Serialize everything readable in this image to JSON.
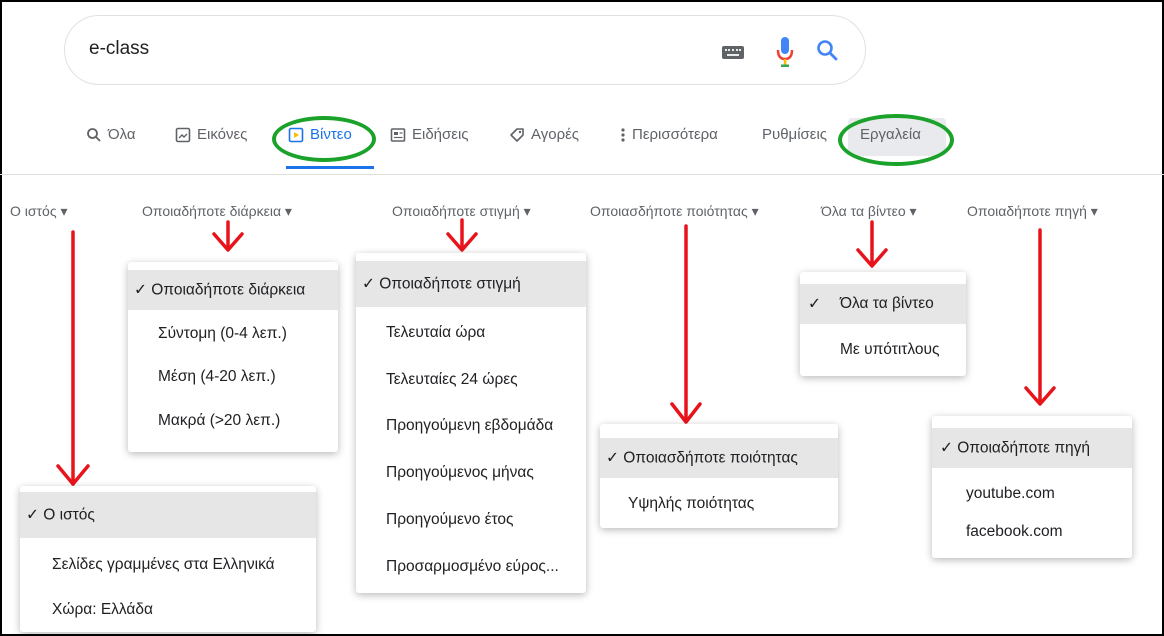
{
  "search": {
    "query": "e-class",
    "keyboard_icon": "keyboard-icon",
    "mic_icon": "mic-icon",
    "search_icon": "search-icon"
  },
  "tabs": [
    {
      "label": "Όλα",
      "icon": "search-icon",
      "active": false
    },
    {
      "label": "Εικόνες",
      "icon": "image-icon",
      "active": false
    },
    {
      "label": "Βίντεο",
      "icon": "video-icon",
      "active": true
    },
    {
      "label": "Ειδήσεις",
      "icon": "news-icon",
      "active": false
    },
    {
      "label": "Αγορές",
      "icon": "tag-icon",
      "active": false
    },
    {
      "label": "Περισσότερα",
      "icon": "more-vert-icon",
      "active": false
    },
    {
      "label": "Ρυθμίσεις",
      "icon": null,
      "active": false
    },
    {
      "label": "Εργαλεία",
      "icon": null,
      "active": false
    }
  ],
  "filters": [
    {
      "label": "Ο ιστός ▾"
    },
    {
      "label": "Οποιαδήποτε διάρκεια ▾"
    },
    {
      "label": "Οποιαδήποτε στιγμή ▾"
    },
    {
      "label": "Οποιασδήποτε ποιότητας ▾"
    },
    {
      "label": "Όλα τα βίντεο ▾"
    },
    {
      "label": "Οποιαδήποτε πηγή ▾"
    }
  ],
  "menus": {
    "duration": [
      "✓ Οποιαδήποτε διάρκεια",
      "Σύντομη (0-4 λεπ.)",
      "Μέση (4-20 λεπ.)",
      "Μακρά (>20 λεπ.)"
    ],
    "time": [
      "✓ Οποιαδήποτε στιγμή",
      "Τελευταία ώρα",
      "Τελευταίες 24 ώρες",
      "Προηγούμενη εβδομάδα",
      "Προηγούμενος μήνας",
      "Προηγούμενο έτος",
      "Προσαρμοσμένο εύρος..."
    ],
    "videos": [
      "✓",
      "Όλα τα βίντεο",
      "Με υπότιτλους"
    ],
    "quality": [
      "✓ Οποιασδήποτε ποιότητας",
      "Υψηλής ποιότητας"
    ],
    "source": [
      "✓ Οποιαδήποτε πηγή",
      "youtube.com",
      "facebook.com"
    ],
    "web": [
      "✓ Ο ιστός",
      "Σελίδες γραμμένες στα Ελληνικά",
      "Χώρα: Ελλάδα"
    ]
  },
  "colors": {
    "accent_blue": "#1a73e8",
    "highlight_green": "#1aa22a",
    "annotation_red": "#e8141c",
    "selected_item_bg": "#e6e6e6"
  }
}
